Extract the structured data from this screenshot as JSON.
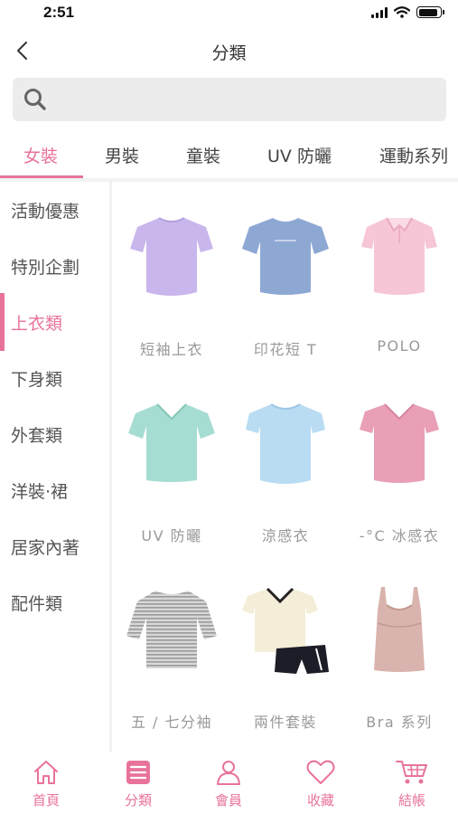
{
  "status_bar": {
    "time": "2:51",
    "battery_level": 0.9
  },
  "header": {
    "title": "分類"
  },
  "search": {
    "placeholder": ""
  },
  "tabs": [
    {
      "label": "女裝",
      "active": true
    },
    {
      "label": "男裝",
      "active": false
    },
    {
      "label": "童裝",
      "active": false
    },
    {
      "label": "UV 防曬",
      "active": false
    },
    {
      "label": "運動系列",
      "active": false
    }
  ],
  "sidebar": {
    "items": [
      {
        "label": "活動優惠",
        "active": false
      },
      {
        "label": "特別企劃",
        "active": false
      },
      {
        "label": "上衣類",
        "active": true
      },
      {
        "label": "下身類",
        "active": false
      },
      {
        "label": "外套類",
        "active": false
      },
      {
        "label": "洋裝‧裙",
        "active": false
      },
      {
        "label": "居家內著",
        "active": false
      },
      {
        "label": "配件類",
        "active": false
      }
    ]
  },
  "products": [
    {
      "label": "短袖上衣",
      "image": "lavender-short-sleeve-tee"
    },
    {
      "label": "印花短 T",
      "image": "blue-print-tee"
    },
    {
      "label": "POLO",
      "image": "pink-polo-shirt"
    },
    {
      "label": "UV 防曬",
      "image": "mint-vneck-tee"
    },
    {
      "label": "涼感衣",
      "image": "light-blue-cool-tee"
    },
    {
      "label": "-°C 冰感衣",
      "image": "pink-vneck-ice-tee"
    },
    {
      "label": "五 / 七分袖",
      "image": "grey-striped-tee"
    },
    {
      "label": "兩件套裝",
      "image": "cream-tee-and-shorts-set"
    },
    {
      "label": "Bra 系列",
      "image": "beige-bra-tank"
    }
  ],
  "bottom_nav": [
    {
      "label": "首頁",
      "icon": "home-icon"
    },
    {
      "label": "分類",
      "icon": "category-icon"
    },
    {
      "label": "會員",
      "icon": "member-icon"
    },
    {
      "label": "收藏",
      "icon": "heart-icon"
    },
    {
      "label": "結帳",
      "icon": "cart-icon"
    }
  ],
  "colors": {
    "accent": "#e8739a",
    "text": "#333333",
    "muted": "#999999",
    "search_bg": "#ececec"
  }
}
